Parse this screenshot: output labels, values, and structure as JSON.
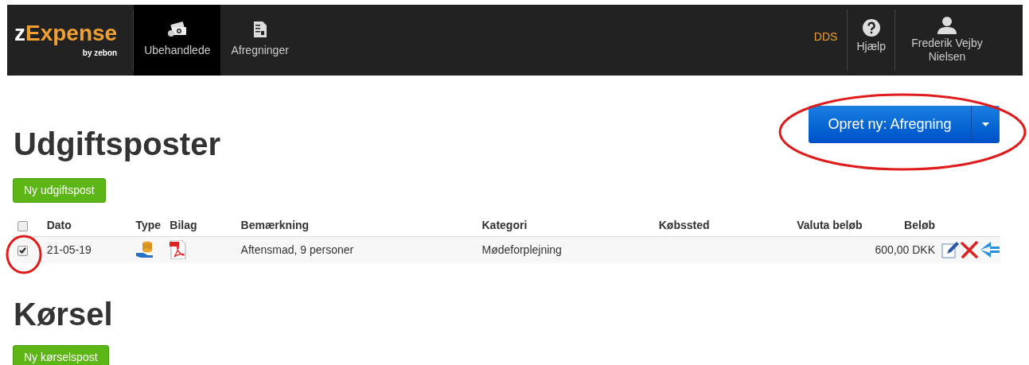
{
  "brand": {
    "name_prefix": "z",
    "name_main": "Expense",
    "byline": "by zebon"
  },
  "nav": [
    {
      "label": "Ubehandlede",
      "kind": "money",
      "selected": true
    },
    {
      "label": "Afregninger",
      "kind": "document",
      "selected": false
    }
  ],
  "company": "DDS",
  "help": {
    "label": "Hjælp"
  },
  "user": {
    "name": "Frederik Vejby Nielsen"
  },
  "create_button": {
    "label": "Opret ny: Afregning"
  },
  "expenses": {
    "title": "Udgiftsposter",
    "add_button": "Ny udgiftspost",
    "columns": [
      "Dato",
      "Type",
      "Bilag",
      "Bemærkning",
      "Kategori",
      "Købssted",
      "Valuta beløb",
      "Beløb"
    ],
    "select_all": {
      "checked": false
    },
    "rows": [
      {
        "checked": true,
        "date": "21-05-19",
        "remark": "Aftensmad, 9 personer",
        "category": "Mødeforplejning",
        "amount": "600,00 DKK"
      }
    ]
  },
  "mileage": {
    "title": "Kørsel",
    "add_button": "Ny kørselspost"
  }
}
